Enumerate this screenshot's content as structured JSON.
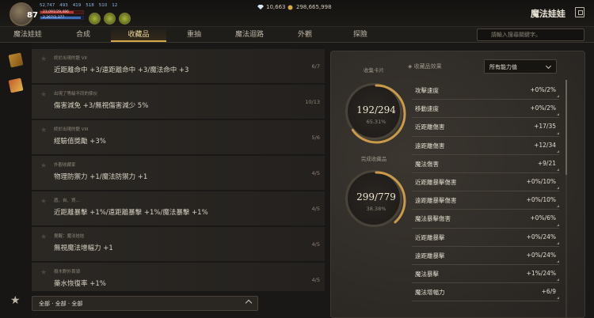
{
  "header": {
    "level": "87",
    "stats": [
      "52,747",
      "493",
      "419",
      "518",
      "510",
      "12"
    ],
    "hp_text": "23,091/29,486",
    "hp_fraction": 0.78,
    "mp_text": "2,267/2,377",
    "mp_fraction": 0.95,
    "diamonds": "10,663",
    "gold": "298,665,998",
    "title": "魔法娃娃"
  },
  "tabs": [
    {
      "label": "魔法娃娃",
      "active": false
    },
    {
      "label": "合成",
      "active": false
    },
    {
      "label": "收藏品",
      "active": true
    },
    {
      "label": "重抽",
      "active": false
    },
    {
      "label": "魔法迴路",
      "active": false
    },
    {
      "label": "外觀",
      "active": false
    },
    {
      "label": "探險",
      "active": false
    }
  ],
  "search": {
    "placeholder": "請輸入搜尋關鍵字。"
  },
  "collections": [
    {
      "category": "終於出現的龍 VII",
      "effect": "近距離命中 +3/遠距離命中 +3/魔法命中 +3",
      "count": "6/7"
    },
    {
      "category": "出現了等級不同的傢伙",
      "effect": "傷害減免 +3/無視傷害減少 5%",
      "count": "10/13"
    },
    {
      "category": "終於出現的龍 VIII",
      "effect": "經驗值獎勵 +3%",
      "count": "5/6"
    },
    {
      "category": "外觀收藏家",
      "effect": "物理防禦力 +1/魔法防禦力 +1",
      "count": "4/5"
    },
    {
      "category": "盾、自、買...",
      "effect": "近距離暴擊 +1%/遠距離暴擊 +1%/魔法暴擊 +1%",
      "count": "4/5"
    },
    {
      "category": "覺醒：魔法娃娃",
      "effect": "無視魔法增幅力 +1",
      "count": "4/5"
    },
    {
      "category": "樹木野外首領",
      "effect": "藥水恢復率 +1%",
      "count": "4/5"
    }
  ],
  "filter": {
    "label": "全部 · 全部 · 全部"
  },
  "summary": {
    "cards_label": "收集卡片",
    "cards_value": "192/294",
    "cards_percent": "65.31%",
    "cards_fraction": 0.6531,
    "completed_label": "完成收藏品",
    "completed_value": "299/779",
    "completed_percent": "38.38%",
    "completed_fraction": 0.3838
  },
  "effects_panel": {
    "heading": "收藏品效果",
    "dropdown": "所有能力值",
    "rows": [
      {
        "name": "攻擊速度",
        "value": "+0%/2%"
      },
      {
        "name": "移動速度",
        "value": "+0%/2%"
      },
      {
        "name": "近距離傷害",
        "value": "+17/35"
      },
      {
        "name": "遠距離傷害",
        "value": "+12/34"
      },
      {
        "name": "魔法傷害",
        "value": "+9/21"
      },
      {
        "name": "近距離暴擊傷害",
        "value": "+0%/10%"
      },
      {
        "name": "遠距離暴擊傷害",
        "value": "+0%/10%"
      },
      {
        "name": "魔法暴擊傷害",
        "value": "+0%/6%"
      },
      {
        "name": "近距離暴擊",
        "value": "+0%/24%"
      },
      {
        "name": "遠距離暴擊",
        "value": "+0%/24%"
      },
      {
        "name": "魔法暴擊",
        "value": "+1%/24%"
      },
      {
        "name": "魔法增幅力",
        "value": "+6/9"
      }
    ]
  },
  "colors": {
    "accent": "#d4a94a",
    "hp": "#b23b2e",
    "mp": "#3b6eb2"
  }
}
